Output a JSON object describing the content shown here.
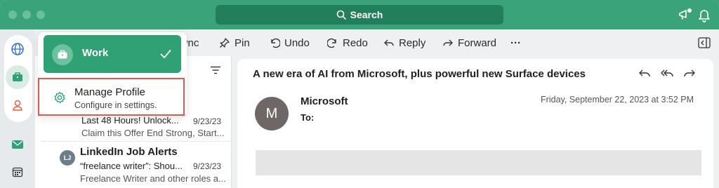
{
  "titlebar": {
    "search_label": "Search"
  },
  "toolbar": {
    "sync_label": "ync",
    "pin_label": "Pin",
    "undo_label": "Undo",
    "redo_label": "Redo",
    "reply_label": "Reply",
    "forward_label": "Forward",
    "more_label": "···"
  },
  "profile_menu": {
    "active_profile": "Work",
    "manage_title": "Manage Profile",
    "manage_subtitle": "Configure in settings."
  },
  "messages": [
    {
      "subject": "Last 48 Hours! Unlock...",
      "date": "9/23/23",
      "preview": "Claim this Offer End Strong, Start..."
    },
    {
      "sender": "LinkedIn Job Alerts",
      "avatar_initials": "LJ",
      "subject": "“freelance writer”: Shou...",
      "date": "9/23/23",
      "preview": "Freelance Writer and other roles a..."
    }
  ],
  "reading_pane": {
    "subject": "A new era of AI from Microsoft, plus powerful new Surface devices",
    "sender": "Microsoft",
    "avatar_initial": "M",
    "to_label": "To:",
    "timestamp": "Friday, September 22, 2023 at 3:52 PM"
  },
  "colors": {
    "brand_green": "#3aa37a",
    "active_green": "#2fa174",
    "highlight_red": "#e2584d"
  }
}
